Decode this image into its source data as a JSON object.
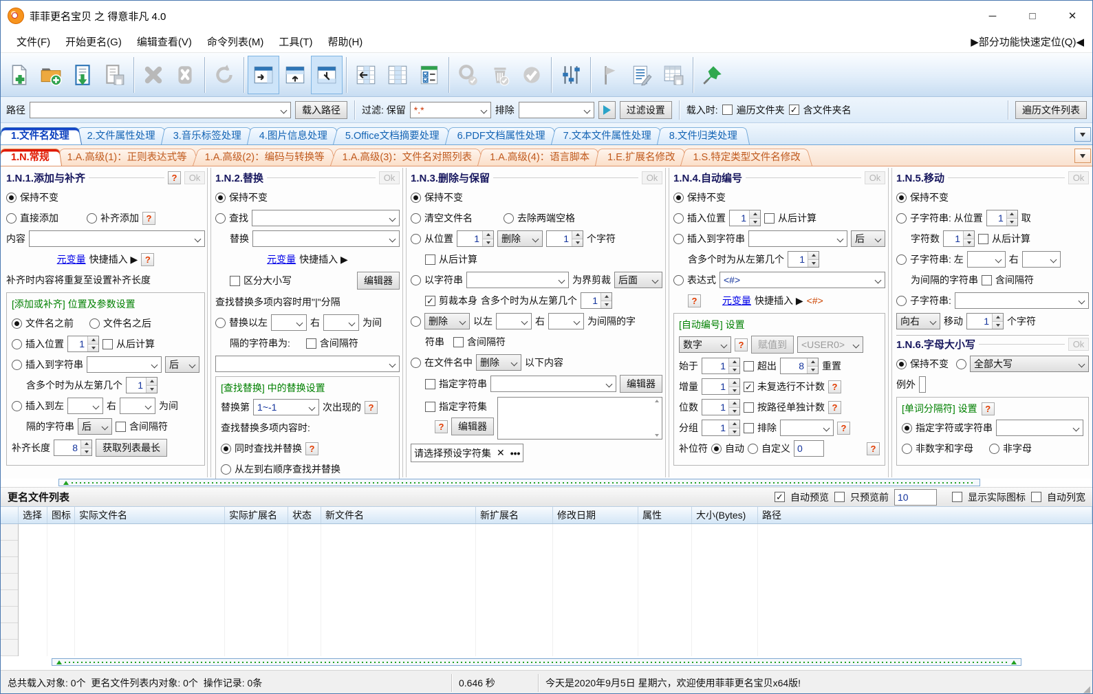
{
  "window": {
    "title": "菲菲更名宝贝 之 得意非凡 4.0",
    "minimize": "─",
    "maximize": "□",
    "close": "✕"
  },
  "menu": {
    "items": [
      "文件(F)",
      "开始更名(G)",
      "编辑查看(V)",
      "命令列表(M)",
      "工具(T)",
      "帮助(H)"
    ],
    "quick_locate": "▶部分功能快速定位(Q)◀"
  },
  "toolbar": {
    "icons": [
      "new-add",
      "open-folder-add",
      "load-list",
      "save-list",
      "delete",
      "clear-list",
      "refresh",
      "panel-right",
      "panel-top",
      "panel-bottom",
      "columns-move-left",
      "columns-view",
      "check-options",
      "search-disabled",
      "delete-disabled",
      "apply-disabled",
      "settings-sliders",
      "flag-marker",
      "command-edit",
      "table-save",
      "pin"
    ]
  },
  "pathbar": {
    "path_label": "路径",
    "load_path": "载入路径",
    "filter_label": "过滤: 保留",
    "filter_value": "*.*",
    "exclude_label": "排除",
    "filter_settings": "过滤设置",
    "onload_label": "载入时:",
    "walk_folders": "遍历文件夹",
    "include_folder": "含文件夹名",
    "walk_list": "遍历文件列表"
  },
  "tabs_main": {
    "items": [
      "1.文件名处理",
      "2.文件属性处理",
      "3.音乐标签处理",
      "4.图片信息处理",
      "5.Office文档摘要处理",
      "6.PDF文档属性处理",
      "7.文本文件属性处理",
      "8.文件归类处理"
    ]
  },
  "tabs_sub": {
    "items": [
      "1.N.常规",
      "1.A.高级(1)：正则表达式等",
      "1.A.高级(2)：编码与转换等",
      "1.A.高级(3)：文件名对照列表",
      "1.A.高级(4)：语言脚本",
      "1.E.扩展名修改",
      "1.S.特定类型文件名修改"
    ]
  },
  "p1": {
    "title": "1.N.1.添加与补齐",
    "ok": "Ok",
    "keep": "保持不变",
    "direct": "直接添加",
    "pad": "补齐添加",
    "content": "内容",
    "metavar": "元变量",
    "quick_insert": "快捷插入 ▶",
    "note": "补齐时内容将重复至设置补齐长度",
    "grp": "[添加或补齐] 位置及参数设置",
    "before": "文件名之前",
    "after": "文件名之后",
    "ins_pos": "插入位置",
    "pos_val": "1",
    "calc_from_end": "从后计算",
    "ins_str": "插入到字符串",
    "after_word": "后",
    "multi_nth": "含多个时为从左第几个",
    "nth_val": "1",
    "ins_left": "插入到左",
    "right_w": "右",
    "wei_jian": "为间",
    "sep_str": "隔的字符串",
    "incl_sep": "含间隔符",
    "pad_len": "补齐长度",
    "pad_val": "8",
    "get_longest": "获取列表最长"
  },
  "p2": {
    "title": "1.N.2.替换",
    "ok": "Ok",
    "keep": "保持不变",
    "find": "查找",
    "replace": "替换",
    "metavar": "元变量",
    "quick_insert": "快捷插入 ▶",
    "case_sens": "区分大小写",
    "editor": "编辑器",
    "note": "查找替换多项内容时用\"|\"分隔",
    "rep_between": "替换以左",
    "right_w": "右",
    "wei_jian": "为间",
    "sep_line": "隔的字符串为:",
    "incl_sep": "含间隔符",
    "grp": "[查找替换] 中的替换设置",
    "rep_nth": "替换第",
    "nth_val": "1~-1",
    "occurrence": "次出现的",
    "multi_note": "查找替换多项内容时:",
    "simul": "同时查找并替换",
    "ltr": "从左到右顺序查找并替换"
  },
  "p3": {
    "title": "1.N.3.删除与保留",
    "ok": "Ok",
    "keep": "保持不变",
    "clear": "清空文件名",
    "trim": "去除两端空格",
    "from_pos": "从位置",
    "pos_val": "1",
    "del_word": "删除",
    "count_val": "1",
    "chars": "个字符",
    "calc_from_end": "从后计算",
    "by_str": "以字符串",
    "cut_bound": "为界剪裁",
    "side": "后面",
    "cut_self": "剪裁本身",
    "multi_nth": "含多个时为从左第几个",
    "nth_val": "1",
    "del2": "删除",
    "yi_left": "以左",
    "right_w": "右",
    "sep_text": "为间隔的字",
    "str_word": "符串",
    "incl_sep": "含间隔符",
    "in_name": "在文件名中",
    "del3": "删除",
    "following": "以下内容",
    "spec_str": "指定字符串",
    "editor": "编辑器",
    "spec_set": "指定字符集",
    "editor2": "编辑器",
    "preset_placeholder": "请选择预设字符集",
    "preset_clear": "✕",
    "preset_more": "•••"
  },
  "p4": {
    "title": "1.N.4.自动编号",
    "ok": "Ok",
    "keep": "保持不变",
    "ins_pos": "插入位置",
    "pos_val": "1",
    "calc_from_end": "从后计算",
    "ins_str": "插入到字符串",
    "after_word": "后",
    "multi_nth": "含多个时为从左第几个",
    "nth_val": "1",
    "expr": "表达式",
    "expr_val": "<#>",
    "metavar": "元变量",
    "quick_insert": "快捷插入 ▶",
    "tag": "<#>",
    "grp": "[自动编号] 设置",
    "type_val": "数字",
    "assign": "赋值到",
    "user_val": "<USER0>",
    "start": "始于",
    "start_val": "1",
    "overflow": "超出",
    "over_val": "8",
    "reset": "重置",
    "inc": "增量",
    "inc_val": "1",
    "uncounted": "未复选行不计数",
    "digits": "位数",
    "dig_val": "1",
    "per_path": "按路径单独计数",
    "group": "分组",
    "grp_val": "1",
    "exclude": "排除",
    "pad_char": "补位符",
    "auto": "自动",
    "custom": "自定义",
    "custom_val": "0"
  },
  "p5": {
    "title": "1.N.5.移动",
    "ok": "Ok",
    "keep": "保持不变",
    "sub1": "子字符串: 从位置",
    "pos_val": "1",
    "take": "取",
    "char_count": "字符数",
    "cnt_val": "1",
    "calc_from_end": "从后计算",
    "sub2": "子字符串: 左",
    "right_w": "右",
    "sep_line": "为间隔的字符串",
    "incl_sep": "含间隔符",
    "sub3": "子字符串:",
    "dir_val": "向右",
    "move": "移动",
    "move_val": "1",
    "chars": "个字符"
  },
  "p6": {
    "title": "1.N.6.字母大小写",
    "ok": "Ok",
    "keep": "保持不变",
    "case_val": "全部大写",
    "except": "例外",
    "grp": "[单词分隔符] 设置",
    "spec": "指定字符或字符串",
    "non_alnum": "非数字和字母",
    "non_alpha": "非字母"
  },
  "list": {
    "title": "更名文件列表",
    "auto_preview": "自动预览",
    "preview_first": "只预览前",
    "preview_count": "10",
    "show_icons": "显示实际图标",
    "auto_width": "自动列宽",
    "columns": [
      "选择",
      "图标",
      "实际文件名",
      "实际扩展名",
      "状态",
      "新文件名",
      "新扩展名",
      "修改日期",
      "属性",
      "大小(Bytes)",
      "路径"
    ]
  },
  "status": {
    "left": "总共载入对象: 0个  更名文件列表内对象: 0个  操作记录: 0条",
    "time": "0.646 秒",
    "welcome": "今天是2020年9月5日 星期六，欢迎使用菲菲更名宝贝x64版!"
  }
}
